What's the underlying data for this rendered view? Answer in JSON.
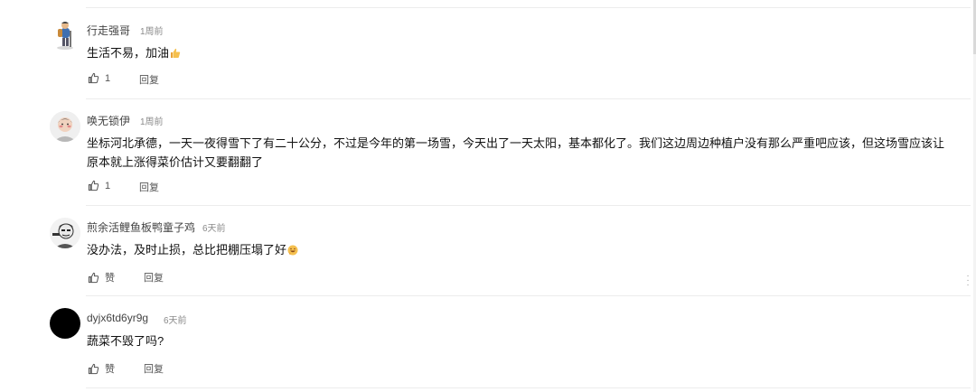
{
  "comments": [
    {
      "author": "行走强哥",
      "time": "1周前",
      "text": "生活不易，加油",
      "emoji_icon": "thumbs-up-emoji-icon",
      "like_label": "1",
      "reply_label": "回复"
    },
    {
      "author": "唤无锁伊",
      "time": "1周前",
      "text": "坐标河北承德，一天一夜得雪下了有二十公分，不过是今年的第一场雪，今天出了一天太阳，基本都化了。我们这边周边种植户没有那么严重吧应该，但这场雪应该让原本就上涨得菜价估计又要翻翻了",
      "like_label": "1",
      "reply_label": "回复"
    },
    {
      "author": "煎余活鲤鱼板鸭童子鸡",
      "time": "6天前",
      "text": "没办法，及时止损，总比把棚压塌了好",
      "emoji_icon": "grin-emoji-icon",
      "like_label": "赞",
      "reply_label": "回复"
    },
    {
      "author": "dyjx6td6yr9g",
      "time": "6天前",
      "text": "蔬菜不毁了吗?",
      "like_label": "赞",
      "reply_label": "回复"
    }
  ],
  "colors": {
    "text": "#111111",
    "muted": "#8a8a8a",
    "divider": "#ececec"
  },
  "icons": {
    "like": "thumbs-up-icon",
    "more": "more-vertical-icon"
  }
}
